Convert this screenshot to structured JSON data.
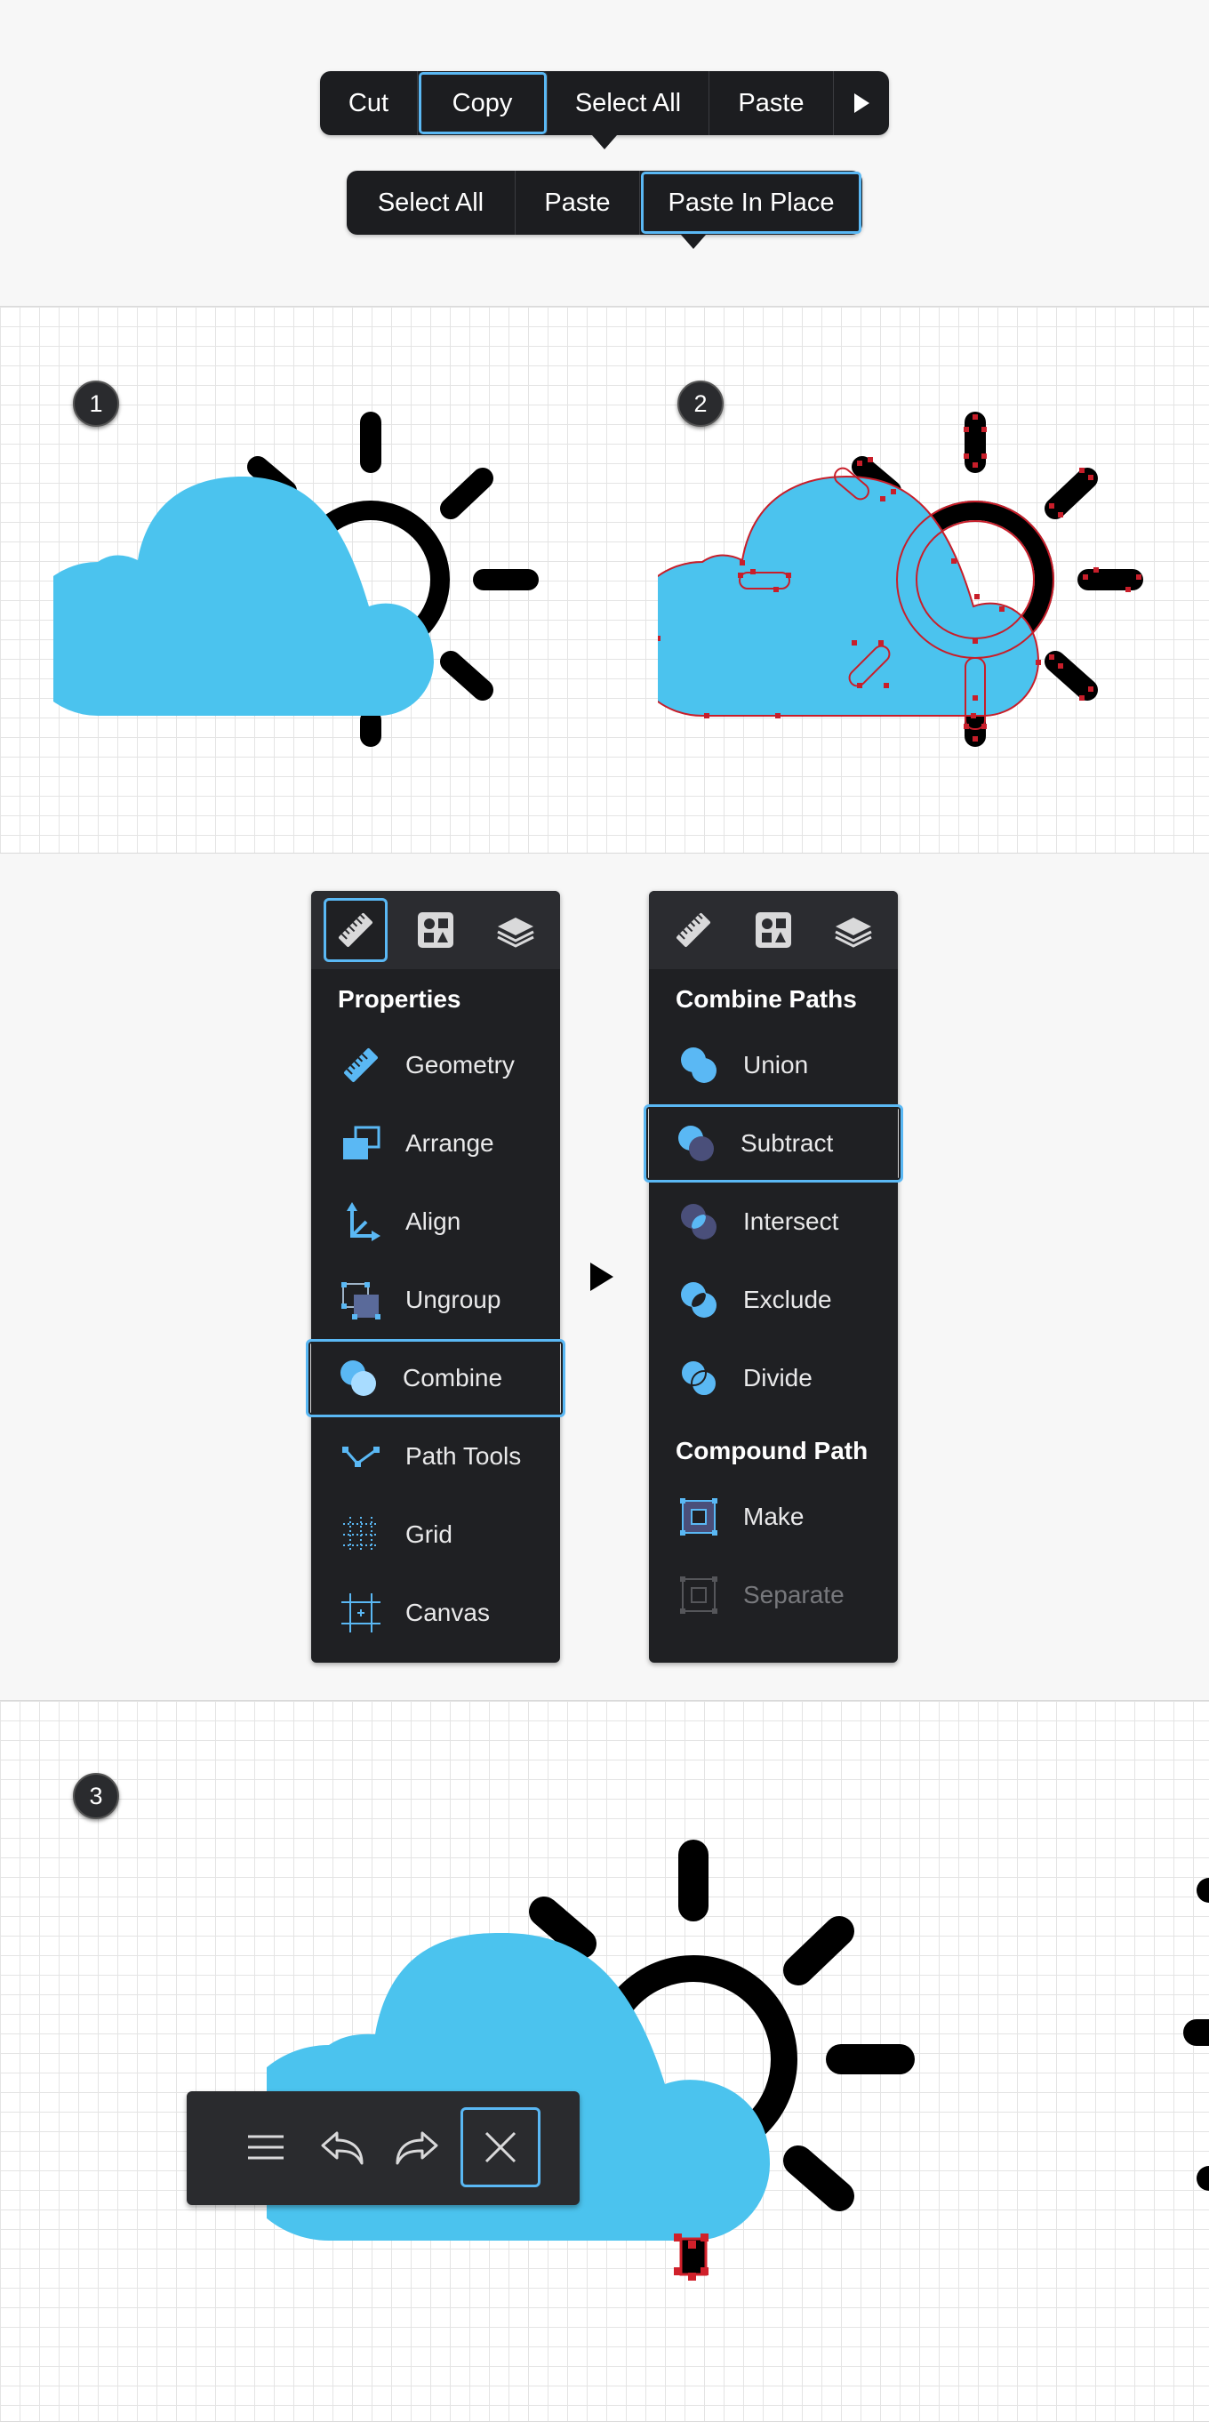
{
  "context_menu_1": {
    "items": [
      {
        "label": "Cut",
        "selected": false
      },
      {
        "label": "Copy",
        "selected": true
      },
      {
        "label": "Select All",
        "selected": false
      },
      {
        "label": "Paste",
        "selected": false
      }
    ],
    "more_icon": "play-triangle-icon"
  },
  "context_menu_2": {
    "items": [
      {
        "label": "Select All",
        "selected": false
      },
      {
        "label": "Paste",
        "selected": false
      },
      {
        "label": "Paste In Place",
        "selected": true
      }
    ]
  },
  "steps": {
    "step1": "1",
    "step2": "2",
    "step3": "3"
  },
  "colors": {
    "cloud_fill": "#4bc3ee",
    "sun_stroke": "#000000",
    "anchor_point": "#d0202a",
    "selection_highlight": "#5ab8f4",
    "panel_bg": "#1f2023"
  },
  "properties_panel": {
    "tabs": [
      {
        "icon": "ruler-icon",
        "selected": true
      },
      {
        "icon": "shapes-icon",
        "selected": false
      },
      {
        "icon": "layers-icon",
        "selected": false
      }
    ],
    "heading": "Properties",
    "items": [
      {
        "label": "Geometry",
        "icon": "ruler-icon"
      },
      {
        "label": "Arrange",
        "icon": "arrange-icon"
      },
      {
        "label": "Align",
        "icon": "align-icon"
      },
      {
        "label": "Ungroup",
        "icon": "ungroup-icon"
      },
      {
        "label": "Combine",
        "icon": "combine-icon",
        "selected": true
      },
      {
        "label": "Path Tools",
        "icon": "path-tools-icon"
      },
      {
        "label": "Grid",
        "icon": "grid-icon"
      },
      {
        "label": "Canvas",
        "icon": "canvas-icon"
      }
    ]
  },
  "combine_panel": {
    "tabs": [
      {
        "icon": "ruler-icon",
        "selected": false
      },
      {
        "icon": "shapes-icon",
        "selected": false
      },
      {
        "icon": "layers-icon",
        "selected": false
      }
    ],
    "heading_combine": "Combine Paths",
    "combine_items": [
      {
        "label": "Union",
        "icon": "union-icon"
      },
      {
        "label": "Subtract",
        "icon": "subtract-icon",
        "selected": true
      },
      {
        "label": "Intersect",
        "icon": "intersect-icon"
      },
      {
        "label": "Exclude",
        "icon": "exclude-icon"
      },
      {
        "label": "Divide",
        "icon": "divide-icon"
      }
    ],
    "heading_compound": "Compound Path",
    "compound_items": [
      {
        "label": "Make",
        "icon": "compound-make-icon"
      },
      {
        "label": "Separate",
        "icon": "compound-separate-icon",
        "disabled": true
      }
    ]
  },
  "toolbar": {
    "buttons": [
      {
        "icon": "menu-icon"
      },
      {
        "icon": "undo-icon"
      },
      {
        "icon": "redo-icon"
      },
      {
        "icon": "close-icon",
        "selected": true
      }
    ]
  }
}
